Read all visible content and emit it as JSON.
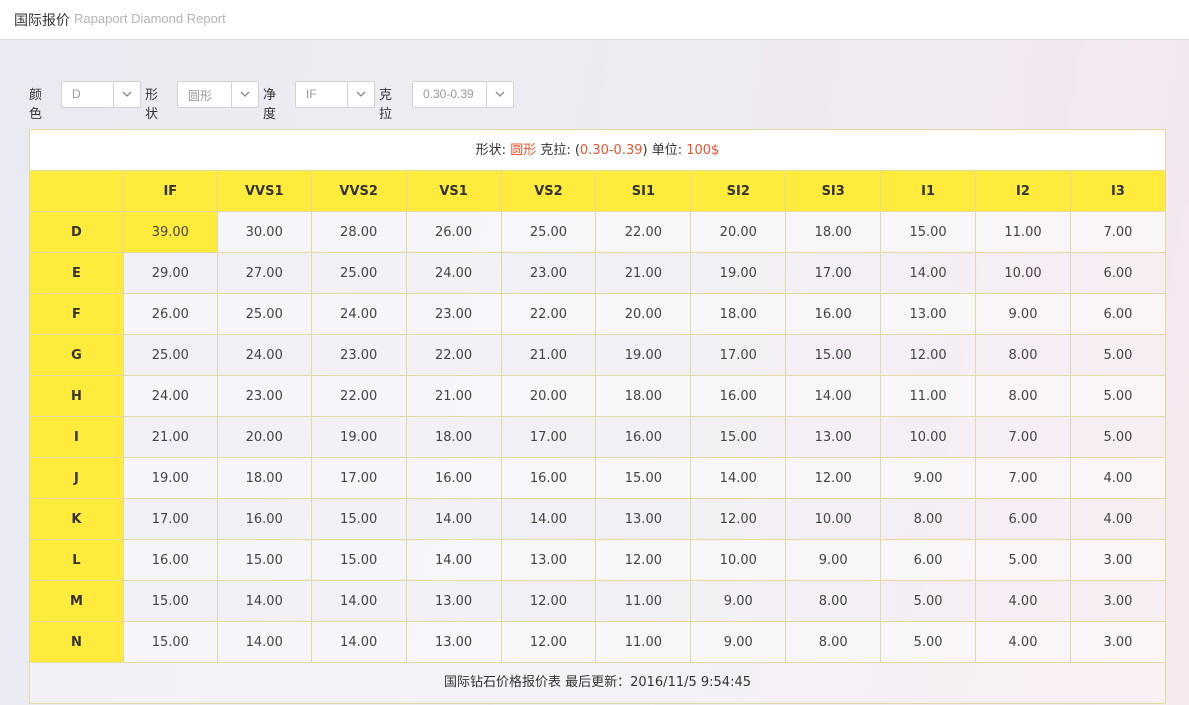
{
  "header": {
    "title": "国际报价",
    "subtitle": "Rapaport Diamond Report"
  },
  "filters": {
    "color_label": "颜色",
    "color_value": "D",
    "shape_label": "形状",
    "shape_value": "圆形",
    "clarity_label": "净度",
    "clarity_value": "IF",
    "carat_label": "克拉",
    "carat_value": "0.30-0.39"
  },
  "caption": {
    "shape_label": "形状: ",
    "shape": "圆形",
    "carat_label": " 克拉: (",
    "carat": "0.30-0.39",
    "carat_close": ") 单位: ",
    "unit": "100$"
  },
  "table": {
    "columns": [
      "IF",
      "VVS1",
      "VVS2",
      "VS1",
      "VS2",
      "SI1",
      "SI2",
      "SI3",
      "I1",
      "I2",
      "I3"
    ],
    "rows": [
      {
        "label": "D",
        "values": [
          "39.00",
          "30.00",
          "28.00",
          "26.00",
          "25.00",
          "22.00",
          "20.00",
          "18.00",
          "15.00",
          "11.00",
          "7.00"
        ]
      },
      {
        "label": "E",
        "values": [
          "29.00",
          "27.00",
          "25.00",
          "24.00",
          "23.00",
          "21.00",
          "19.00",
          "17.00",
          "14.00",
          "10.00",
          "6.00"
        ]
      },
      {
        "label": "F",
        "values": [
          "26.00",
          "25.00",
          "24.00",
          "23.00",
          "22.00",
          "20.00",
          "18.00",
          "16.00",
          "13.00",
          "9.00",
          "6.00"
        ]
      },
      {
        "label": "G",
        "values": [
          "25.00",
          "24.00",
          "23.00",
          "22.00",
          "21.00",
          "19.00",
          "17.00",
          "15.00",
          "12.00",
          "8.00",
          "5.00"
        ]
      },
      {
        "label": "H",
        "values": [
          "24.00",
          "23.00",
          "22.00",
          "21.00",
          "20.00",
          "18.00",
          "16.00",
          "14.00",
          "11.00",
          "8.00",
          "5.00"
        ]
      },
      {
        "label": "I",
        "values": [
          "21.00",
          "20.00",
          "19.00",
          "18.00",
          "17.00",
          "16.00",
          "15.00",
          "13.00",
          "10.00",
          "7.00",
          "5.00"
        ]
      },
      {
        "label": "J",
        "values": [
          "19.00",
          "18.00",
          "17.00",
          "16.00",
          "16.00",
          "15.00",
          "14.00",
          "12.00",
          "9.00",
          "7.00",
          "4.00"
        ]
      },
      {
        "label": "K",
        "values": [
          "17.00",
          "16.00",
          "15.00",
          "14.00",
          "14.00",
          "13.00",
          "12.00",
          "10.00",
          "8.00",
          "6.00",
          "4.00"
        ]
      },
      {
        "label": "L",
        "values": [
          "16.00",
          "15.00",
          "15.00",
          "14.00",
          "13.00",
          "12.00",
          "10.00",
          "9.00",
          "6.00",
          "5.00",
          "3.00"
        ]
      },
      {
        "label": "M",
        "values": [
          "15.00",
          "14.00",
          "14.00",
          "13.00",
          "12.00",
          "11.00",
          "9.00",
          "8.00",
          "5.00",
          "4.00",
          "3.00"
        ]
      },
      {
        "label": "N",
        "values": [
          "15.00",
          "14.00",
          "14.00",
          "13.00",
          "12.00",
          "11.00",
          "9.00",
          "8.00",
          "5.00",
          "4.00",
          "3.00"
        ]
      }
    ],
    "highlight": {
      "row": "D",
      "column": "IF"
    }
  },
  "footer": "国际钻石价格报价表 最后更新：2016/11/5 9:54:45",
  "colors": {
    "header_yellow": "#ffeb3b",
    "accent_red": "#f0512c",
    "border": "#e2d9a3"
  }
}
